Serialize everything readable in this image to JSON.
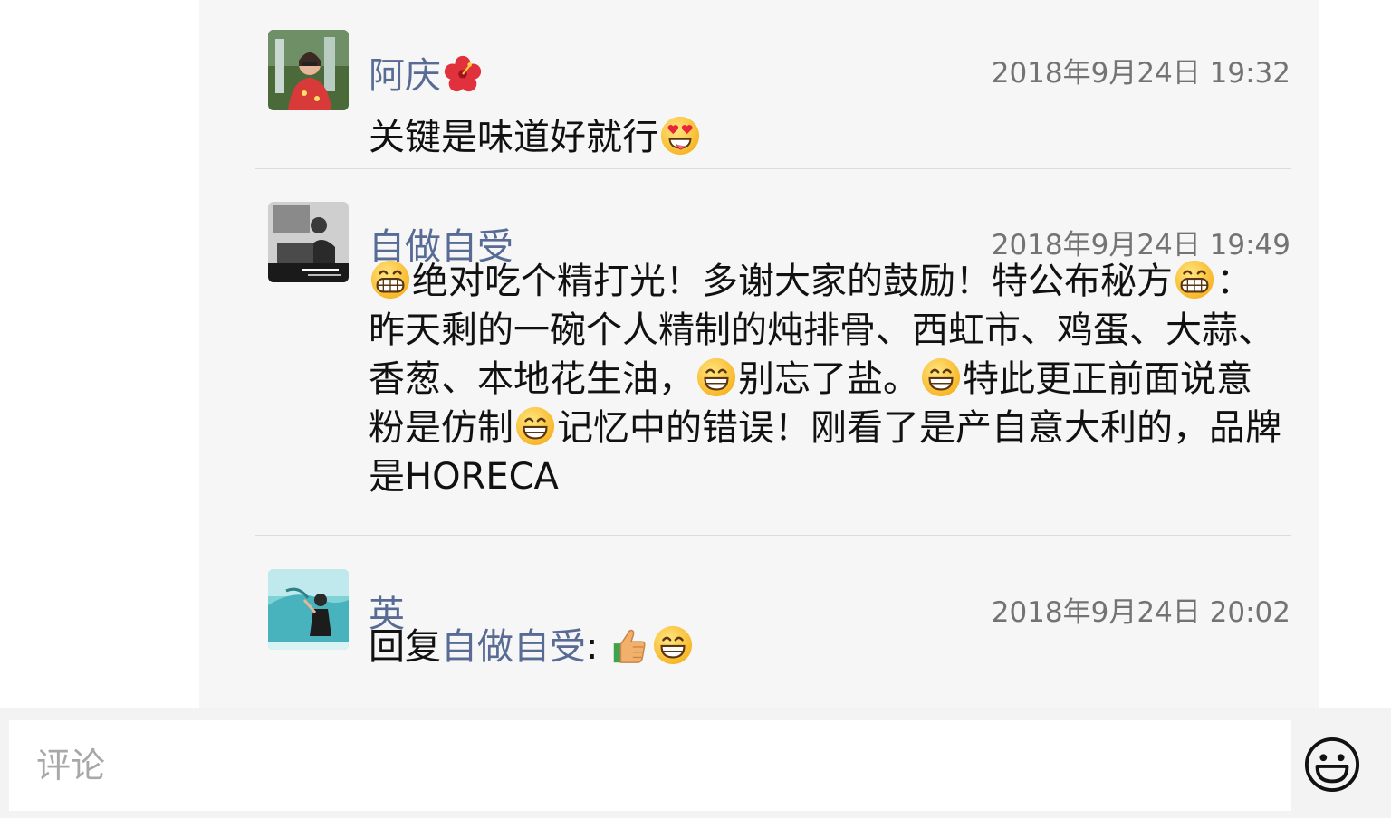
{
  "comments": [
    {
      "author": "阿庆",
      "time": "2018年9月24日 19:32",
      "text": "关键是味道好就行",
      "name_emoji": "hibiscus-icon",
      "text_emoji": "star-struck-drooling-icon"
    },
    {
      "author": "自做自受",
      "time": "2018年9月24日 19:49",
      "text_parts": [
        "绝对吃个精打光！多谢大家的鼓励！特公布秘方",
        "：昨天剩的一碗个人精制的炖排骨、西虹市、鸡蛋、大蒜、香葱、本地花生油，",
        "别忘了盐。",
        "特此更正前面说意粉是仿制",
        "记忆中的错误！刚看了是产自意大利的，品牌是HORECA"
      ]
    },
    {
      "author": "英",
      "time": "2018年9月24日 20:02",
      "reply_prefix": "回复",
      "reply_to": "自做自受",
      "reply_colon": ":"
    }
  ],
  "input": {
    "placeholder": "评论"
  },
  "colors": {
    "author_link": "#576b95",
    "panel_background": "#f6f6f6",
    "timestamp": "#737373"
  }
}
